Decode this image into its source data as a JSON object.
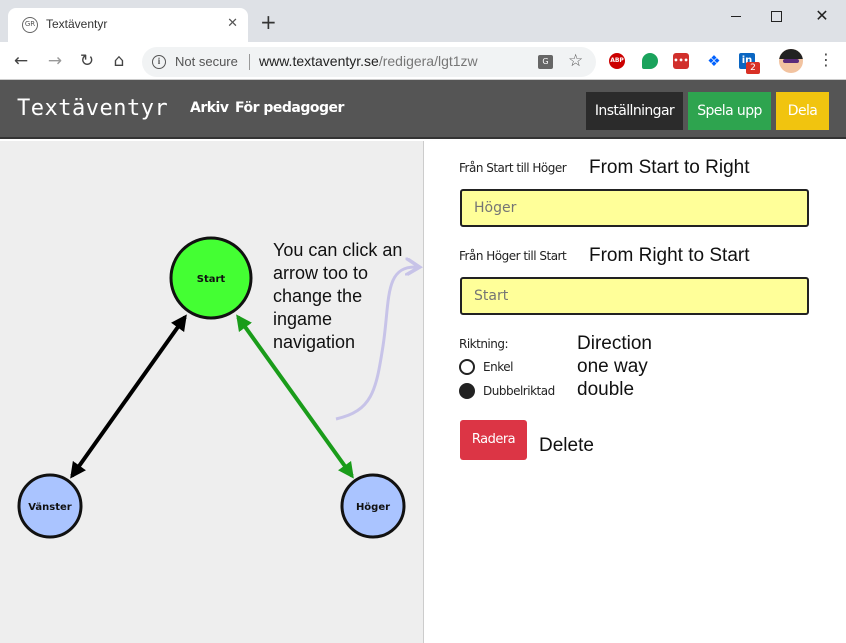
{
  "browser": {
    "tab_title": "Textäventyr",
    "tab_favicon": "GR",
    "new_tab": "+",
    "security_label": "Not secure",
    "url_host": "www.textaventyr.se",
    "url_path": "/redigera/lgt1zw",
    "extensions": {
      "abp": "ABP",
      "red": "•••",
      "linkedin": "in",
      "linkedin_badge": "2"
    }
  },
  "header": {
    "logo": "Textäventyr",
    "nav": {
      "archive": "Arkiv",
      "teachers": "För pedagoger"
    },
    "buttons": {
      "settings": "Inställningar",
      "play": "Spela upp",
      "share": "Dela"
    }
  },
  "graph": {
    "nodes": {
      "start": "Start",
      "left": "Vänster",
      "right": "Höger"
    },
    "note": "You can click an arrow too to change the ingame navigation",
    "colors": {
      "start_node": "#44ff33",
      "other_nodes": "#aac4ff",
      "selected_edge": "#1a9c1a",
      "edge": "#000000",
      "note_arrow": "#c7c3e8"
    }
  },
  "panel": {
    "from_start_label": "Från Start till Höger",
    "from_start_annotation": "From Start to Right",
    "from_start_placeholder": "Höger",
    "from_right_label": "Från Höger till Start",
    "from_right_annotation": "From Right to Start",
    "from_right_placeholder": "Start",
    "direction_label": "Riktning:",
    "direction_annotation": "Direction",
    "option_single": "Enkel",
    "option_single_annotation": "one way",
    "option_double": "Dubbelriktad",
    "option_double_annotation": "double",
    "selected_option": "Dubbelriktad",
    "delete_label": "Radera",
    "delete_annotation": "Delete",
    "field_color": "#ffff99",
    "delete_color": "#dc3545"
  }
}
